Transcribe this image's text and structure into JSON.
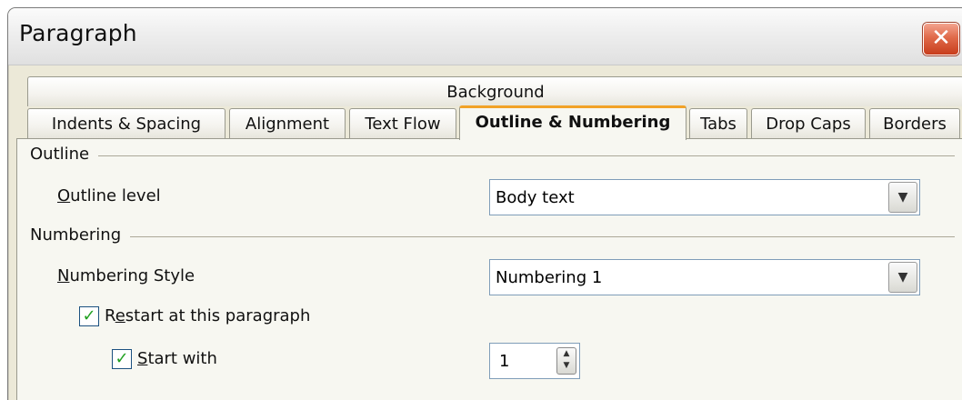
{
  "window": {
    "title": "Paragraph",
    "close_symbol": "✕"
  },
  "tabs": {
    "row1": [
      "Background"
    ],
    "row2": [
      "Indents & Spacing",
      "Alignment",
      "Text Flow",
      "Outline & Numbering",
      "Tabs",
      "Drop Caps",
      "Borders"
    ],
    "active": "Outline & Numbering"
  },
  "outline": {
    "section_label": "Outline",
    "level_label_first": "O",
    "level_label_rest": "utline level",
    "level_value": "Body text"
  },
  "numbering": {
    "section_label": "Numbering",
    "style_label_first": "N",
    "style_label_rest": "umbering Style",
    "style_value": "Numbering 1",
    "restart_label_pre": "R",
    "restart_label_u": "e",
    "restart_label_rest": "start at this paragraph",
    "restart_checked": true,
    "startwith_label_first": "S",
    "startwith_label_rest": "tart with",
    "startwith_checked": true,
    "startwith_value": "1"
  },
  "icons": {
    "dropdown": "chevron-down-icon",
    "check": "checkmark-icon",
    "spin": "spin-arrows-icon"
  }
}
